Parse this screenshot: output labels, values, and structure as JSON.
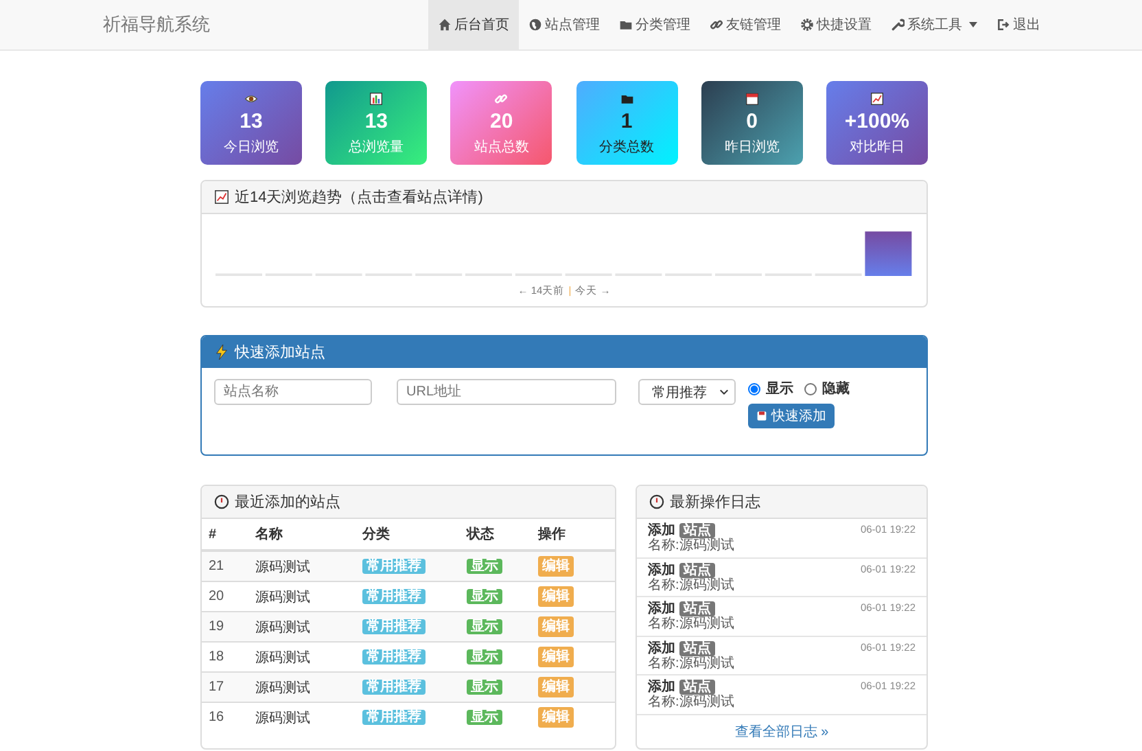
{
  "navbar": {
    "brand": "祈福导航系统",
    "items": [
      {
        "label": "后台首页",
        "selected": true,
        "dropdown": false
      },
      {
        "label": "站点管理",
        "selected": false,
        "dropdown": false
      },
      {
        "label": "分类管理",
        "selected": false,
        "dropdown": false
      },
      {
        "label": "友链管理",
        "selected": false,
        "dropdown": false
      },
      {
        "label": "快捷设置",
        "selected": false,
        "dropdown": false
      },
      {
        "label": "系统工具",
        "selected": false,
        "dropdown": true
      },
      {
        "label": "退出",
        "selected": false,
        "dropdown": false
      }
    ]
  },
  "stats": [
    {
      "value": "13",
      "label": "今日浏览"
    },
    {
      "value": "13",
      "label": "总浏览量"
    },
    {
      "value": "20",
      "label": "站点总数"
    },
    {
      "value": "1",
      "label": "分类总数"
    },
    {
      "value": "0",
      "label": "昨日浏览"
    },
    {
      "value": "+100%",
      "label": "对比昨日"
    }
  ],
  "trend": {
    "title": "近14天浏览趋势（点击查看站点详情)",
    "caption_left": "← 14天前",
    "caption_sep": "|",
    "caption_right": "今天 →"
  },
  "quick_add": {
    "title": "快速添加站点",
    "name_field": {
      "placeholder": "站点名称"
    },
    "url_field": {
      "placeholder": "URL地址"
    },
    "category_select": {
      "value": "常用推荐"
    },
    "visibility": [
      {
        "label": "显示",
        "selected": true
      },
      {
        "label": "隐藏",
        "selected": false
      }
    ],
    "button": "快速添加"
  },
  "recent_sites": {
    "title": "最近添加的站点",
    "columns": [
      "#",
      "名称",
      "分类",
      "状态",
      "操作"
    ],
    "rows": [
      {
        "id": "21",
        "name": "源码测试",
        "category": "常用推荐",
        "status": "显示",
        "action": "编辑"
      },
      {
        "id": "20",
        "name": "源码测试",
        "category": "常用推荐",
        "status": "显示",
        "action": "编辑"
      },
      {
        "id": "19",
        "name": "源码测试",
        "category": "常用推荐",
        "status": "显示",
        "action": "编辑"
      },
      {
        "id": "18",
        "name": "源码测试",
        "category": "常用推荐",
        "status": "显示",
        "action": "编辑"
      },
      {
        "id": "17",
        "name": "源码测试",
        "category": "常用推荐",
        "status": "显示",
        "action": "编辑"
      },
      {
        "id": "16",
        "name": "源码测试",
        "category": "常用推荐",
        "status": "显示",
        "action": "编辑"
      }
    ]
  },
  "log": {
    "title": "最新操作日志",
    "entries": [
      {
        "action": "添加",
        "tag": "站点",
        "detail": "名称:源码测试",
        "time": "06-01 19:22"
      },
      {
        "action": "添加",
        "tag": "站点",
        "detail": "名称:源码测试",
        "time": "06-01 19:22"
      },
      {
        "action": "添加",
        "tag": "站点",
        "detail": "名称:源码测试",
        "time": "06-01 19:22"
      },
      {
        "action": "添加",
        "tag": "站点",
        "detail": "名称:源码测试",
        "time": "06-01 19:22"
      },
      {
        "action": "添加",
        "tag": "站点",
        "detail": "名称:源码测试",
        "time": "06-01 19:22"
      }
    ],
    "more_link": "查看全部日志 »"
  }
}
